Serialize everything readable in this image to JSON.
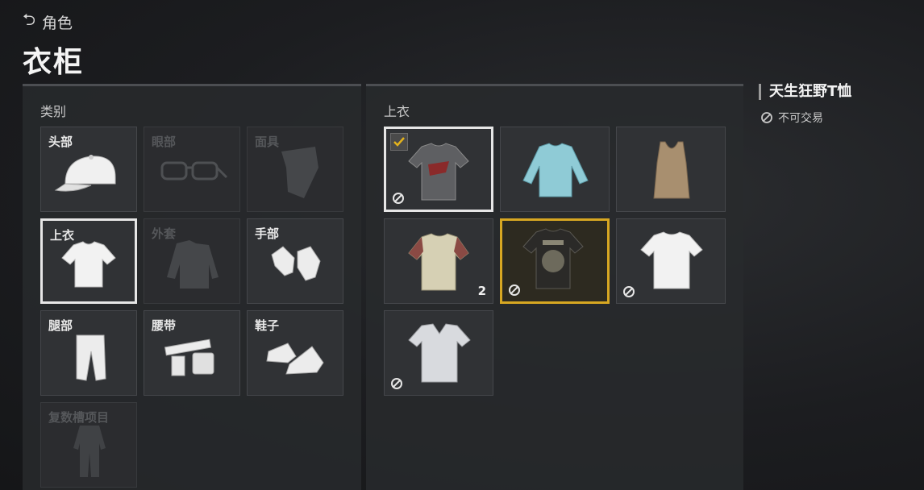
{
  "nav": {
    "back_label": "角色",
    "page_title": "衣柜"
  },
  "category_panel": {
    "title": "类别",
    "items": [
      {
        "label": "头部",
        "icon": "cap-icon",
        "enabled": true
      },
      {
        "label": "眼部",
        "icon": "glasses-icon",
        "enabled": false
      },
      {
        "label": "面具",
        "icon": "bandana-icon",
        "enabled": false
      },
      {
        "label": "上衣",
        "icon": "tshirt-icon",
        "enabled": true,
        "selected": true
      },
      {
        "label": "外套",
        "icon": "jacket-icon",
        "enabled": false
      },
      {
        "label": "手部",
        "icon": "gloves-icon",
        "enabled": true
      },
      {
        "label": "腿部",
        "icon": "pants-icon",
        "enabled": true
      },
      {
        "label": "腰带",
        "icon": "belt-icon",
        "enabled": true
      },
      {
        "label": "鞋子",
        "icon": "shoes-icon",
        "enabled": true
      },
      {
        "label": "复数槽项目",
        "icon": "suit-icon",
        "enabled": false
      }
    ]
  },
  "items_panel": {
    "title": "上衣",
    "items": [
      {
        "name": "printed-gray-tshirt",
        "equipped": true,
        "untradeable": true
      },
      {
        "name": "blue-long-sleeve"
      },
      {
        "name": "tan-tank-top"
      },
      {
        "name": "raglan-tshirt",
        "count": "2"
      },
      {
        "name": "black-graphic-tshirt",
        "highlighted": true,
        "untradeable": true
      },
      {
        "name": "white-tshirt",
        "untradeable": true
      },
      {
        "name": "gray-vneck-tshirt",
        "untradeable": true
      }
    ]
  },
  "detail": {
    "item_name": "天生狂野T恤",
    "trade_status": "不可交易"
  },
  "colors": {
    "highlight": "#d7a722",
    "check": "#e3b21c"
  }
}
